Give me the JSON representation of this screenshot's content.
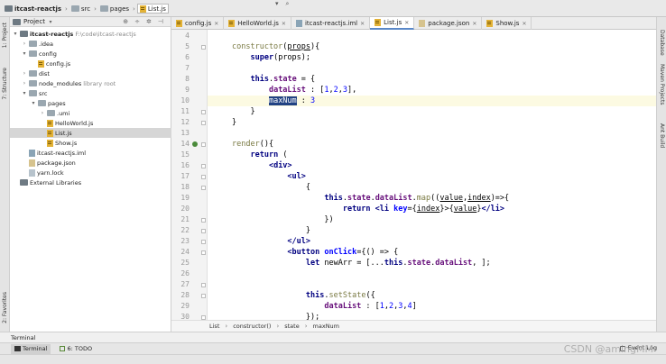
{
  "breadcrumb": [
    "itcast-reactjs",
    "src",
    "pages",
    "List.js"
  ],
  "topbar_controls": [
    "▾",
    "⌕"
  ],
  "left_strip": {
    "project": "1: Project",
    "structure": "7: Structure",
    "favorites": "2: Favorites"
  },
  "project_panel": {
    "title": "Project",
    "tree": [
      {
        "name": "itcast-reactjs",
        "hint": "F:\\code\\itcast-reactjs",
        "level": 0,
        "type": "folder-root",
        "expanded": true
      },
      {
        "name": ".idea",
        "level": 1,
        "type": "folder",
        "expanded": false
      },
      {
        "name": "config",
        "level": 1,
        "type": "folder",
        "expanded": true
      },
      {
        "name": "config.js",
        "level": 2,
        "type": "js"
      },
      {
        "name": "dist",
        "level": 1,
        "type": "folder",
        "expanded": false
      },
      {
        "name": "node_modules",
        "hint": "library root",
        "level": 1,
        "type": "folder",
        "expanded": false
      },
      {
        "name": "src",
        "level": 1,
        "type": "folder",
        "expanded": true
      },
      {
        "name": "pages",
        "level": 2,
        "type": "folder",
        "expanded": true
      },
      {
        "name": ".umi",
        "level": 3,
        "type": "folder",
        "expanded": false
      },
      {
        "name": "HelloWorld.js",
        "level": 3,
        "type": "js"
      },
      {
        "name": "List.js",
        "level": 3,
        "type": "js",
        "selected": true
      },
      {
        "name": "Show.js",
        "level": 3,
        "type": "js"
      },
      {
        "name": "itcast-reactjs.iml",
        "level": 1,
        "type": "iml"
      },
      {
        "name": "package.json",
        "level": 1,
        "type": "json"
      },
      {
        "name": "yarn.lock",
        "level": 1,
        "type": "yarn"
      },
      {
        "name": "External Libraries",
        "level": 0,
        "type": "lib"
      }
    ]
  },
  "tabs": [
    {
      "label": "config.js",
      "type": "js"
    },
    {
      "label": "HelloWorld.js",
      "type": "js"
    },
    {
      "label": "itcast-reactjs.iml",
      "type": "iml"
    },
    {
      "label": "List.js",
      "type": "js",
      "active": true
    },
    {
      "label": "package.json",
      "type": "json"
    },
    {
      "label": "Show.js",
      "type": "js"
    }
  ],
  "editor": {
    "line_numbers": [
      "4",
      "5",
      "6",
      "7",
      "8",
      "9",
      "10",
      "11",
      "12",
      "13",
      "14",
      "15",
      "16",
      "17",
      "18",
      "19",
      "20",
      "21",
      "22",
      "23",
      "24",
      "25",
      "26",
      "27",
      "28",
      "29",
      "30"
    ],
    "highlighted_line": "10",
    "lines": [
      [],
      [
        {
          "t": "constructor",
          "c": "fn"
        },
        {
          "t": "("
        },
        {
          "t": "props",
          "c": "param"
        },
        {
          "t": "){"
        }
      ],
      [
        {
          "t": "    "
        },
        {
          "t": "super",
          "c": "kw"
        },
        {
          "t": "(props);"
        }
      ],
      [],
      [
        {
          "t": "    "
        },
        {
          "t": "this",
          "c": "kw"
        },
        {
          "t": "."
        },
        {
          "t": "state",
          "c": "prop"
        },
        {
          "t": " = {"
        }
      ],
      [
        {
          "t": "        "
        },
        {
          "t": "dataList",
          "c": "prop"
        },
        {
          "t": " : ["
        },
        {
          "t": "1",
          "c": "num"
        },
        {
          "t": ","
        },
        {
          "t": "2",
          "c": "num"
        },
        {
          "t": ","
        },
        {
          "t": "3",
          "c": "num"
        },
        {
          "t": "],"
        }
      ],
      [
        {
          "t": "        "
        },
        {
          "t": "maxNum",
          "c": "selword"
        },
        {
          "t": " : "
        },
        {
          "t": "3",
          "c": "num"
        }
      ],
      [
        {
          "t": "    }"
        }
      ],
      [
        {
          "t": "}"
        }
      ],
      [],
      [
        {
          "t": "render",
          "c": "fn"
        },
        {
          "t": "(){"
        }
      ],
      [
        {
          "t": "    "
        },
        {
          "t": "return",
          "c": "kw"
        },
        {
          "t": " ("
        }
      ],
      [
        {
          "t": "        "
        },
        {
          "t": "<div>",
          "c": "tag"
        }
      ],
      [
        {
          "t": "            "
        },
        {
          "t": "<ul>",
          "c": "tag"
        }
      ],
      [
        {
          "t": "                {"
        }
      ],
      [
        {
          "t": "                    "
        },
        {
          "t": "this",
          "c": "kw"
        },
        {
          "t": "."
        },
        {
          "t": "state",
          "c": "prop"
        },
        {
          "t": "."
        },
        {
          "t": "dataList",
          "c": "prop"
        },
        {
          "t": "."
        },
        {
          "t": "map",
          "c": "fn"
        },
        {
          "t": "(("
        },
        {
          "t": "value",
          "c": "param"
        },
        {
          "t": ","
        },
        {
          "t": "index",
          "c": "param"
        },
        {
          "t": ")=>{"
        }
      ],
      [
        {
          "t": "                        "
        },
        {
          "t": "return",
          "c": "kw"
        },
        {
          "t": " "
        },
        {
          "t": "<li ",
          "c": "tag"
        },
        {
          "t": "key",
          "c": "attr"
        },
        {
          "t": "={"
        },
        {
          "t": "index",
          "c": "param"
        },
        {
          "t": "}>{"
        },
        {
          "t": "value",
          "c": "param"
        },
        {
          "t": "}"
        },
        {
          "t": "</li>",
          "c": "tag"
        }
      ],
      [
        {
          "t": "                    })"
        }
      ],
      [
        {
          "t": "                }"
        }
      ],
      [
        {
          "t": "            "
        },
        {
          "t": "</ul>",
          "c": "tag"
        }
      ],
      [
        {
          "t": "            "
        },
        {
          "t": "<button ",
          "c": "tag"
        },
        {
          "t": "onClick",
          "c": "attr"
        },
        {
          "t": "={() => {"
        }
      ],
      [
        {
          "t": "                "
        },
        {
          "t": "let",
          "c": "kw"
        },
        {
          "t": " newArr = [..."
        },
        {
          "t": "this",
          "c": "kw"
        },
        {
          "t": "."
        },
        {
          "t": "state",
          "c": "prop"
        },
        {
          "t": "."
        },
        {
          "t": "dataList",
          "c": "prop"
        },
        {
          "t": ", ];"
        }
      ],
      [],
      [],
      [
        {
          "t": "                "
        },
        {
          "t": "this",
          "c": "kw"
        },
        {
          "t": "."
        },
        {
          "t": "setState",
          "c": "fn"
        },
        {
          "t": "({"
        }
      ],
      [
        {
          "t": "                    "
        },
        {
          "t": "dataList",
          "c": "prop"
        },
        {
          "t": " : ["
        },
        {
          "t": "1",
          "c": "num"
        },
        {
          "t": ","
        },
        {
          "t": "2",
          "c": "num"
        },
        {
          "t": ","
        },
        {
          "t": "3",
          "c": "num"
        },
        {
          "t": ","
        },
        {
          "t": "4",
          "c": "num"
        },
        {
          "t": "]"
        }
      ],
      [
        {
          "t": "                });"
        }
      ]
    ]
  },
  "code_breadcrumb": [
    "List",
    "constructor()",
    "state",
    "maxNum"
  ],
  "right_strip": [
    "Database",
    "Maven Projects",
    "Ant Build"
  ],
  "terminal_label": "Terminal",
  "bottom_tabs": [
    {
      "label": "Terminal",
      "active": true
    },
    {
      "label": "6: TODO"
    }
  ],
  "event_log": "Event Log",
  "watermark": "CSDN @amingMM"
}
